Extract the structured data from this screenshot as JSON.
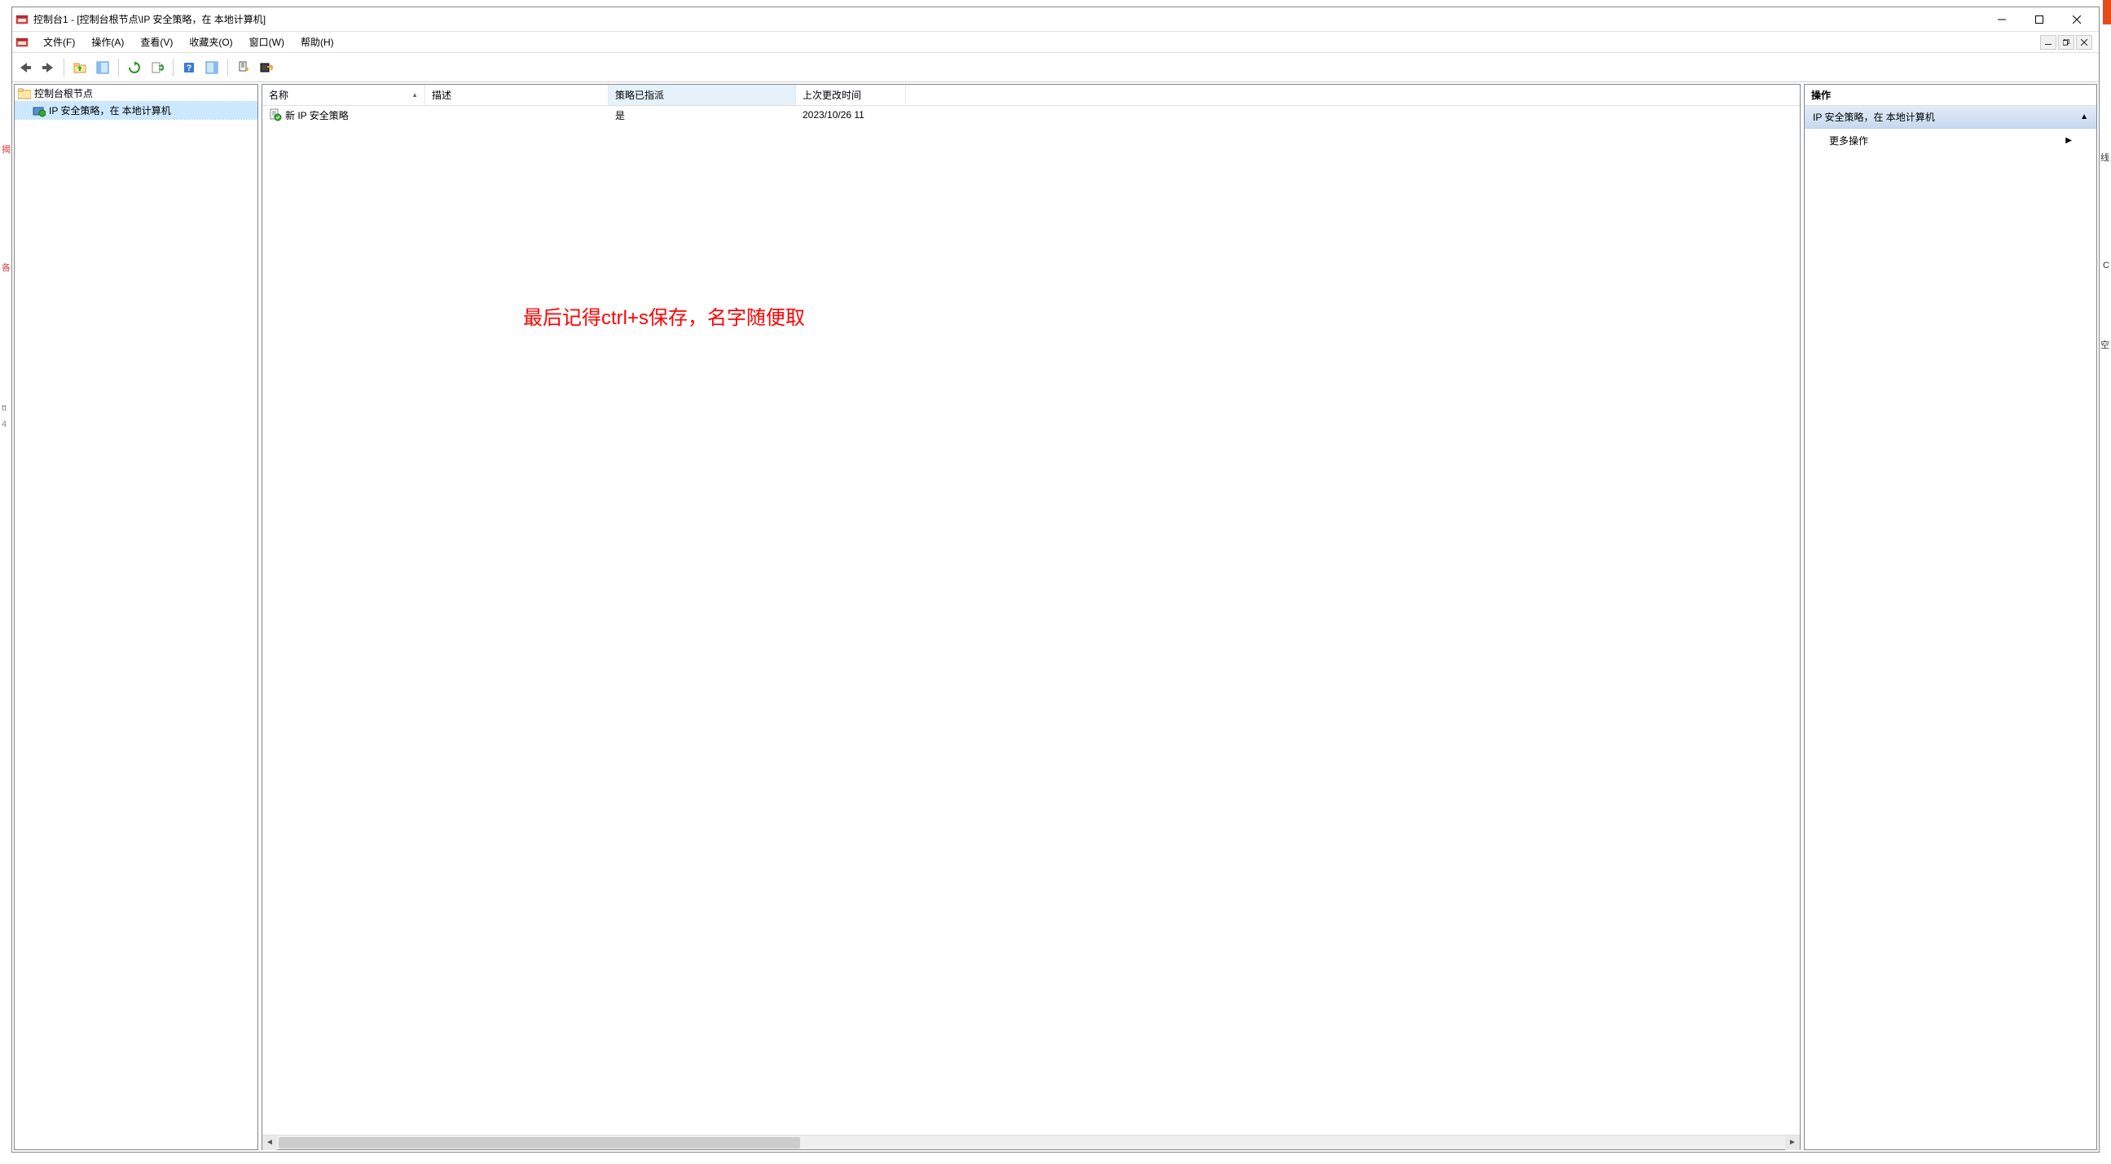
{
  "window": {
    "title": "控制台1 - [控制台根节点\\IP 安全策略，在 本地计算机]"
  },
  "menu": {
    "file": "文件(F)",
    "action": "操作(A)",
    "view": "查看(V)",
    "favorites": "收藏夹(O)",
    "window": "窗口(W)",
    "help": "帮助(H)"
  },
  "tree": {
    "root": "控制台根节点",
    "child": "IP 安全策略，在 本地计算机"
  },
  "list": {
    "columns": {
      "name": "名称",
      "desc": "描述",
      "assigned": "策略已指派",
      "modified": "上次更改时间"
    },
    "rows": [
      {
        "name": "新 IP 安全策略",
        "desc": "",
        "assigned": "是",
        "modified": "2023/10/26 11"
      }
    ]
  },
  "actions": {
    "header": "操作",
    "section": "IP 安全策略，在 本地计算机",
    "more": "更多操作"
  },
  "annotation": "最后记得ctrl+s保存，名字随便取",
  "bg": {
    "left1": "各",
    "left2": "tt",
    "left3": "4",
    "left4": "揭",
    "right1": "线",
    "right2": "C",
    "right3": "空"
  }
}
